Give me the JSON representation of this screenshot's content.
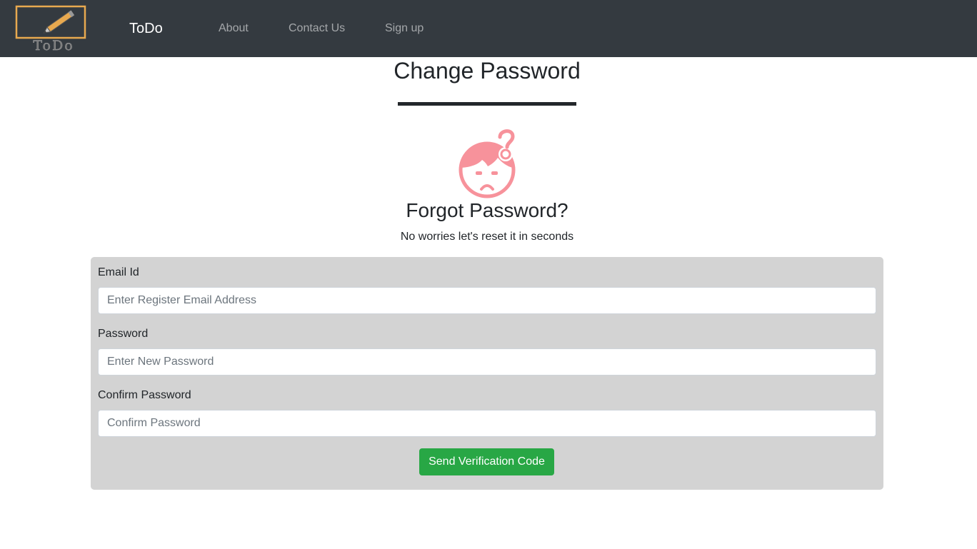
{
  "navbar": {
    "logo_text": "ToDo",
    "brand": "ToDo",
    "links": [
      "About",
      "Contact Us",
      "Sign up"
    ]
  },
  "header": {
    "title": "Change Password"
  },
  "hero": {
    "icon": "confused-face-icon",
    "title": "Forgot Password?",
    "subtitle": "No worries let's reset it in seconds"
  },
  "form": {
    "email_label": "Email Id",
    "email_placeholder": "Enter Register Email Address",
    "password_label": "Password",
    "password_placeholder": "Enter New Password",
    "confirm_label": "Confirm Password",
    "confirm_placeholder": "Confirm Password",
    "submit_label": "Send Verification Code"
  },
  "colors": {
    "navbar_bg": "#343a40",
    "logo_accent": "#e8a94f",
    "icon_pink": "#f7929b",
    "form_bg": "#d3d3d3",
    "button_green": "#28a745"
  }
}
